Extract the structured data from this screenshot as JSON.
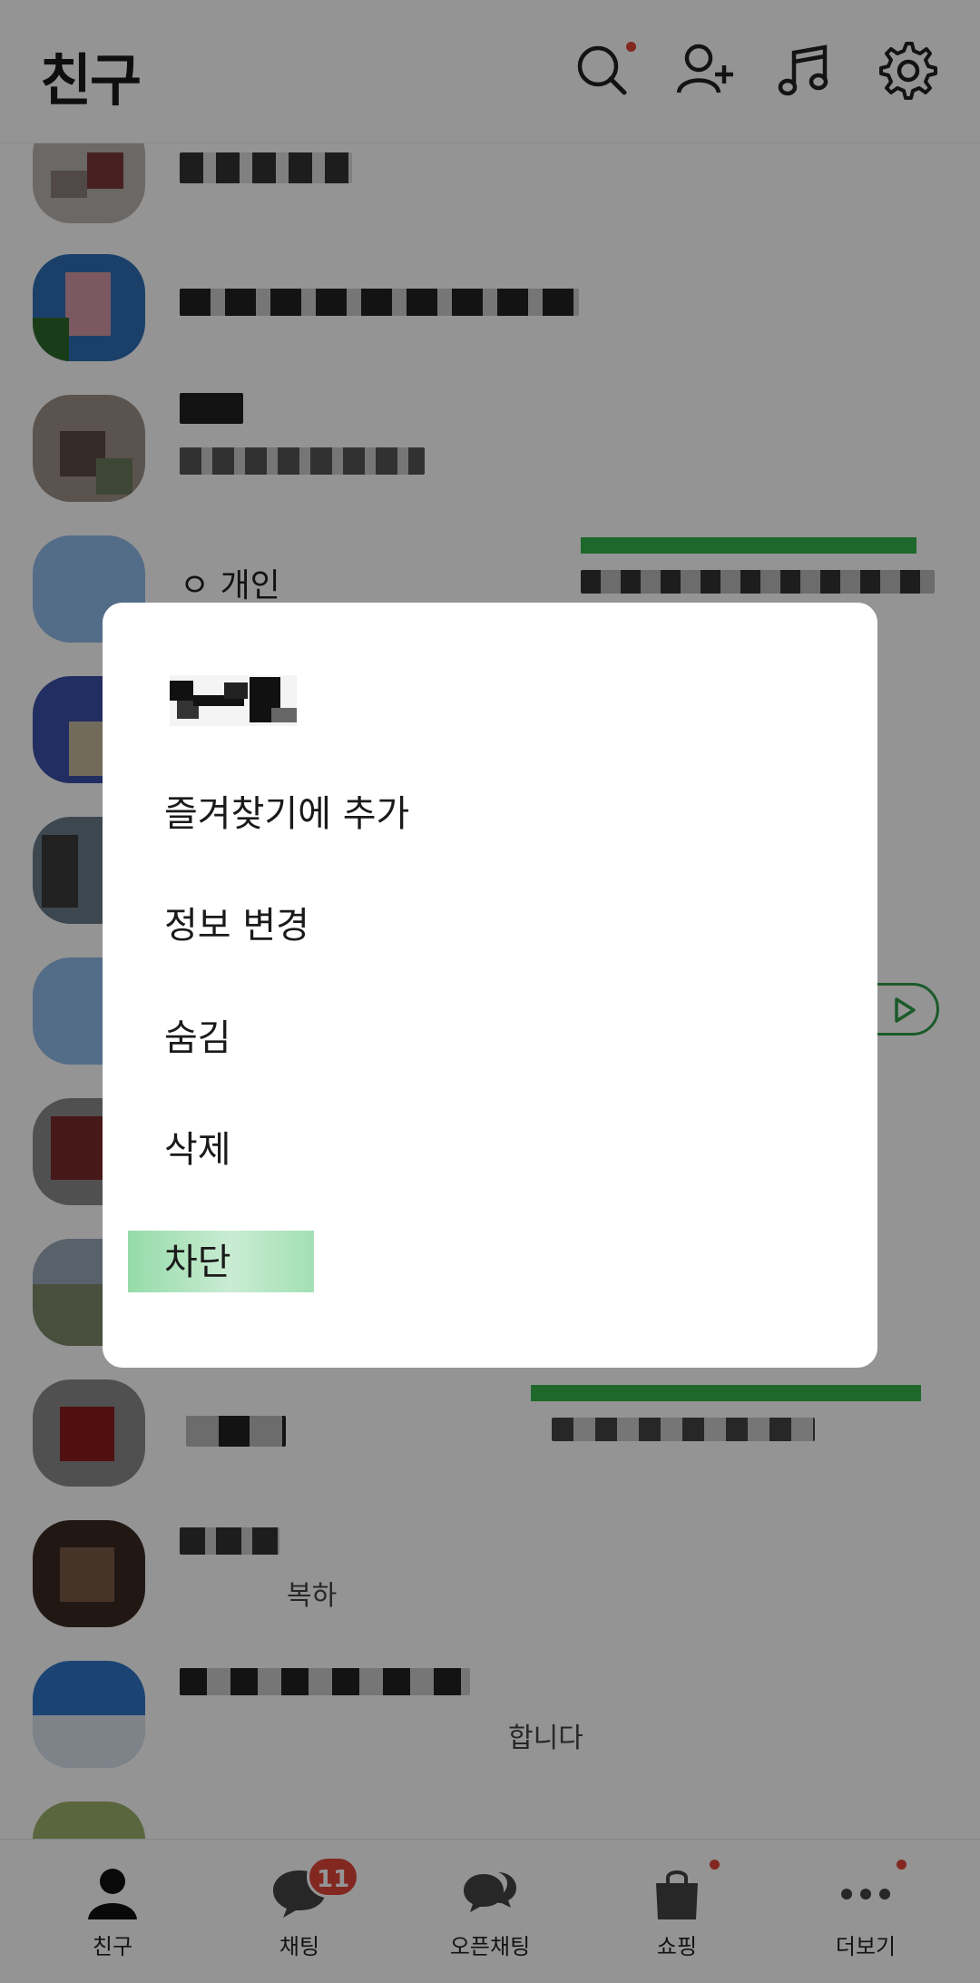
{
  "header": {
    "title": "친구",
    "icons": [
      "search-icon",
      "add-friend-icon",
      "music-icon",
      "settings-icon"
    ],
    "search_has_notification": true
  },
  "friend_list": {
    "rows": [
      {
        "partial_text": ""
      },
      {
        "partial_text": ""
      },
      {
        "partial_text": ""
      },
      {
        "partial_text": "ㅇ 개인"
      },
      {
        "partial_text": ""
      },
      {
        "partial_text": ""
      },
      {
        "partial_text": ""
      },
      {
        "partial_text": ""
      },
      {
        "partial_text": ""
      },
      {
        "partial_text": ""
      },
      {
        "partial_text": "복하"
      },
      {
        "partial_text": "합니다"
      }
    ]
  },
  "dialog": {
    "title_redacted": true,
    "items": [
      {
        "label": "즐겨찾기에 추가"
      },
      {
        "label": "정보 변경"
      },
      {
        "label": "숨김"
      },
      {
        "label": "삭제"
      },
      {
        "label": "차단",
        "highlighted": true
      }
    ]
  },
  "bottom_nav": {
    "items": [
      {
        "label": "친구",
        "icon": "person-icon",
        "active": true
      },
      {
        "label": "채팅",
        "icon": "chat-bubble-icon",
        "badge": "11"
      },
      {
        "label": "오픈채팅",
        "icon": "open-chat-icon"
      },
      {
        "label": "쇼핑",
        "icon": "shopping-bag-icon",
        "dot": true
      },
      {
        "label": "더보기",
        "icon": "more-dots-icon",
        "dot": true
      }
    ]
  },
  "colors": {
    "accent_green": "#2f9c48",
    "badge_red": "#e0463a",
    "highlight_green": "#95dba8",
    "overlay": "rgba(0,0,0,0.42)"
  }
}
